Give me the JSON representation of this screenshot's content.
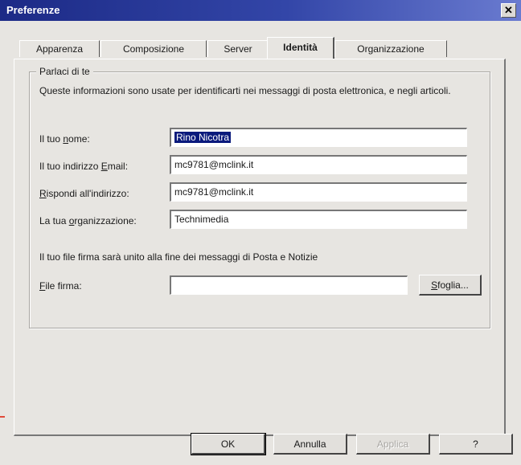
{
  "window": {
    "title": "Preferenze",
    "close_icon": "✕"
  },
  "tabs": [
    {
      "label": "Apparenza",
      "active": false
    },
    {
      "label": "Composizione",
      "active": false
    },
    {
      "label": "Server",
      "active": false
    },
    {
      "label": "Identità",
      "active": true
    },
    {
      "label": "Organizzazione",
      "active": false
    }
  ],
  "group": {
    "title": "Parlaci di te",
    "intro": "Queste informazioni sono usate per identificarti nei messaggi di posta elettronica, e negli articoli."
  },
  "fields": {
    "name": {
      "label_pre": "Il tuo ",
      "label_key": "n",
      "label_post": "ome:",
      "value": "Rino Nicotra"
    },
    "email": {
      "label_pre": "Il tuo indirizzo ",
      "label_key": "E",
      "label_post": "mail:",
      "value": "mc9781@mclink.it"
    },
    "reply": {
      "label_pre": "",
      "label_key": "R",
      "label_post": "ispondi all'indirizzo:",
      "value": "mc9781@mclink.it"
    },
    "org": {
      "label_pre": "La tua ",
      "label_key": "o",
      "label_post": "rganizzazione:",
      "value": "Technimedia"
    }
  },
  "signature": {
    "note": "Il tuo file firma sarà unito alla fine dei messaggi di Posta e Notizie",
    "label_key": "F",
    "label_post": "ile firma:",
    "value": "",
    "browse_key": "S",
    "browse_post": "foglia..."
  },
  "buttons": {
    "ok": "OK",
    "cancel": "Annulla",
    "apply": "Applica",
    "help": "?"
  },
  "colors": {
    "titlebar": "#1c2a86",
    "selection": "#0a1a7c"
  }
}
